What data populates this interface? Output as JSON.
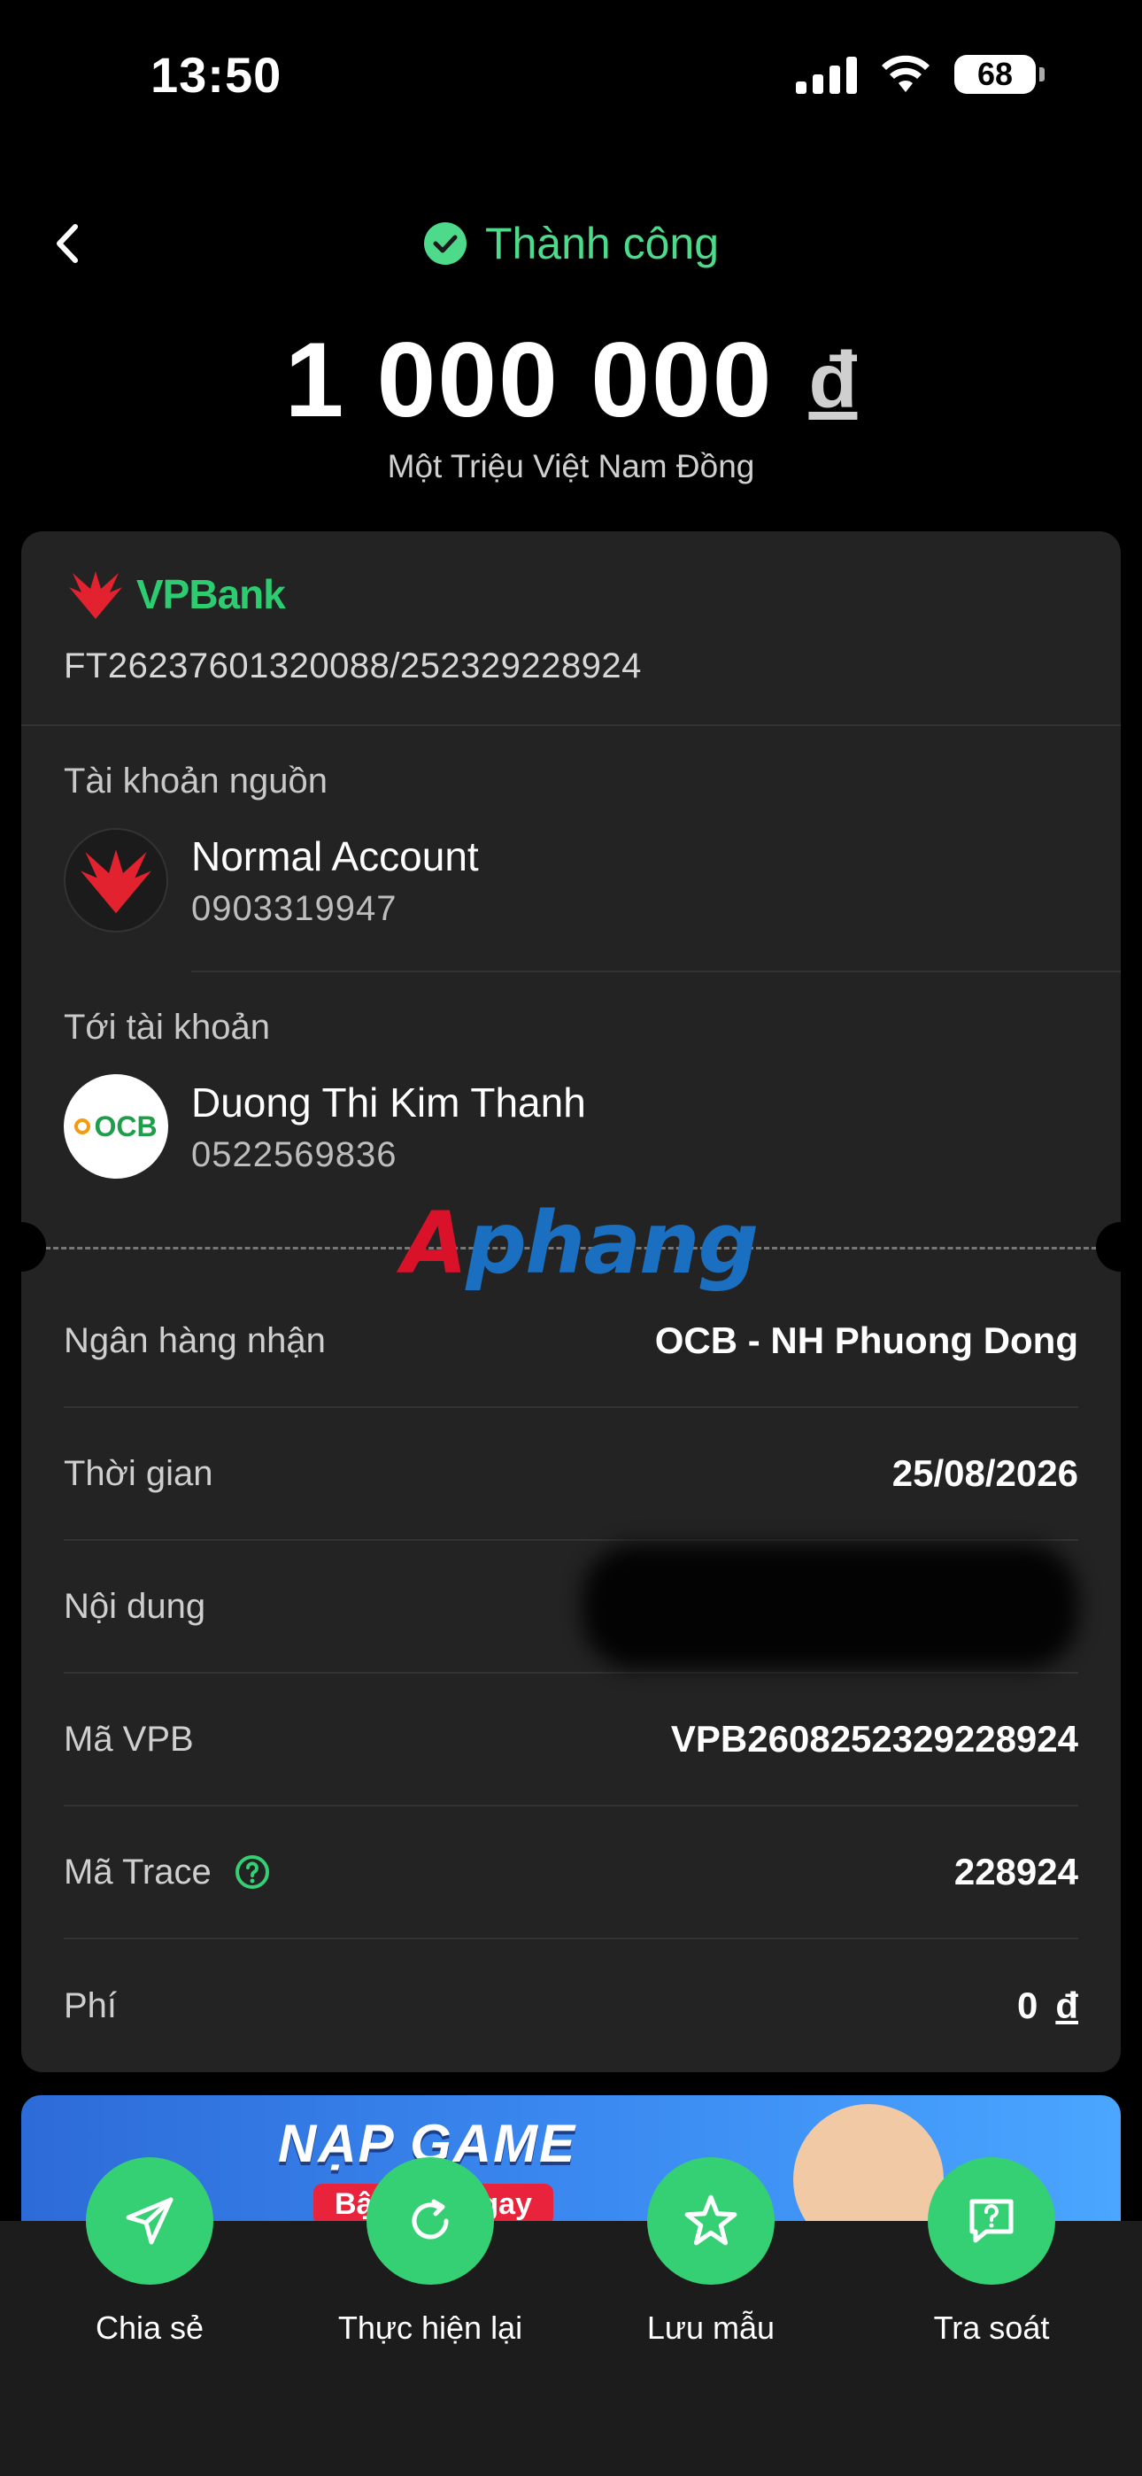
{
  "status_bar": {
    "time": "13:50",
    "battery": "68",
    "battery_level": 0.68
  },
  "header": {
    "status": "Thành công",
    "amount": "1 000 000",
    "currency": "đ",
    "amount_words": "Một Triệu Việt Nam Đồng"
  },
  "card": {
    "bank_logo_text": "VPBank",
    "reference": "FT26237601320088/252329228924",
    "from": {
      "label": "Tài khoản nguồn",
      "name": "Normal Account",
      "account": "0903319947"
    },
    "to": {
      "label": "Tới tài khoản",
      "name": "Duong Thi Kim Thanh",
      "account": "0522569836",
      "bank_logo_text": "OCB"
    },
    "watermark": {
      "part1": "A",
      "part2": "phang"
    },
    "rows": [
      {
        "label": "Ngân hàng nhận",
        "value": "OCB - NH Phuong Dong"
      },
      {
        "label": "Thời gian",
        "value": "25/08/2026"
      },
      {
        "label": "Nội dung",
        "value": ""
      },
      {
        "label": "Mã VPB",
        "value": "VPB2608252329228924"
      },
      {
        "label": "Mã Trace",
        "value": "228924"
      },
      {
        "label": "Phí",
        "value": "0",
        "currency": "đ"
      }
    ]
  },
  "banner": {
    "title": "NẠP GAME",
    "subtitle": "Bật n...n ngay"
  },
  "actions": [
    {
      "label": "Chia sẻ",
      "icon": "send-icon"
    },
    {
      "label": "Thực hiện lại",
      "icon": "refresh-icon"
    },
    {
      "label": "Lưu mẫu",
      "icon": "star-icon"
    },
    {
      "label": "Tra soát",
      "icon": "message-icon"
    }
  ],
  "colors": {
    "success": "#4ddb8b",
    "action": "#35d074",
    "card": "#232323",
    "vpbank_red": "#e3222f",
    "vpbank_green": "#2ecc71"
  }
}
